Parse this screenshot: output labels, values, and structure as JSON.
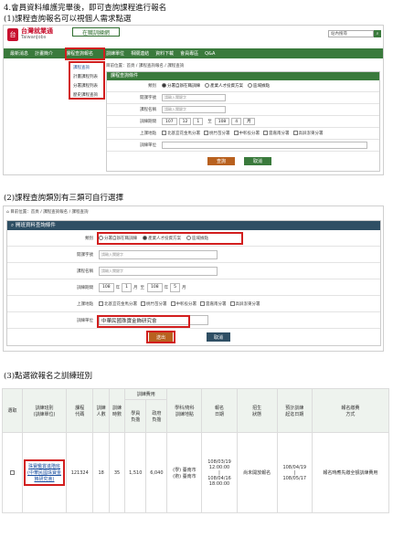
{
  "headings": {
    "h1": "4.會員資料維護完畢後，即可查詢課程進行報名",
    "h2": "(1)課程查詢報名可以視個人需求點選",
    "h3": "(2)課程查詢類別有三類可自行選擇",
    "h4": "(3)點選欲報名之訓練班別"
  },
  "s1": {
    "logo_cn": "台灣就業通",
    "logo_en": "TaiwanJobs",
    "site_badge": "在職訓練網",
    "search_placeholder": "站內搜尋",
    "nav": [
      "最新消息",
      "計畫簡介",
      "課程查詢報名",
      "訓練單位",
      "相關連結",
      "資料下載",
      "會員專區",
      "Q&A"
    ],
    "dropdown": [
      "課程查詢",
      "計畫課程列表",
      "分署課程列表",
      "歷史課程查詢"
    ],
    "breadcrumb": "目前位置：首頁 / 課程查詢報名 / 課程查詢",
    "panel_title": "課程查詢條件",
    "labels": [
      "類別",
      "開課字號",
      "課程名稱",
      "訓練期間",
      "上課地點",
      "訓練單位"
    ],
    "category_options": [
      "分署自辦在職訓練",
      "產業人才投資方案",
      "區域據點"
    ],
    "ph_code": "請輸入關鍵字",
    "ph_name": "請輸入關鍵字",
    "dates": [
      "107",
      "12",
      "1",
      "108",
      "4",
      "月"
    ],
    "locations": [
      "北基宜花金馬分署",
      "桃竹苗分署",
      "中彰投分署",
      "雲嘉南分署",
      "高屏澎東分署"
    ],
    "btn_query": "查詢",
    "btn_cancel": "取消"
  },
  "s2": {
    "breadcrumb": "目前位置：首頁 / 課程查詢報名 / 課程查詢",
    "panel_title": "開班資料查詢條件",
    "labels": [
      "類別",
      "開課字號",
      "課程名稱",
      "訓練期間",
      "上課地點",
      "訓練單位"
    ],
    "category_options": [
      "分署自辦在職訓練",
      "產業人才投資方案",
      "區域據點"
    ],
    "ph_code": "請輸入關鍵字",
    "ph_name": "請輸入關鍵字",
    "date": {
      "y1": "108",
      "m1": "1",
      "d1": "月",
      "y2": "108",
      "m2": "5",
      "d2": "月",
      "sep": "至"
    },
    "locations": [
      "北基宜花金馬分署",
      "桃竹苗分署",
      "中彰投分署",
      "雲嘉南分署",
      "高屏澎東分署"
    ],
    "unit_value": "中華民國珠寶金飾研究會",
    "btn_query": "送出",
    "btn_cancel": "取消"
  },
  "s3": {
    "group_header": "訓練費用",
    "headers": [
      "選取",
      "訓練班別\n(訓練單位)",
      "課程\n代碼",
      "訓練\n人數",
      "訓練\n時數",
      "學員\n負擔",
      "政府\n負擔",
      "學科/術科\n訓練地點",
      "報名\n日期",
      "招生\n狀態",
      "預計訓練\n起迄日期",
      "報名繳費\n方式"
    ],
    "row": {
      "course": "珠寶鑑賞進階班\n(中華民國珠寶金飾研究會)",
      "code": "121324",
      "people": "18",
      "hours": "35",
      "student_fee": "1,510",
      "gov_fee": "6,040",
      "location": "(學) 臺南市\n(術) 臺南市",
      "signup": "108/03/19\n12:00:00\n|\n108/04/16\n18:00:00",
      "status": "尚未開放報名",
      "period": "108/04/19\n|\n108/05/17",
      "payment": "報名時應先繳全額訓練費用"
    }
  }
}
